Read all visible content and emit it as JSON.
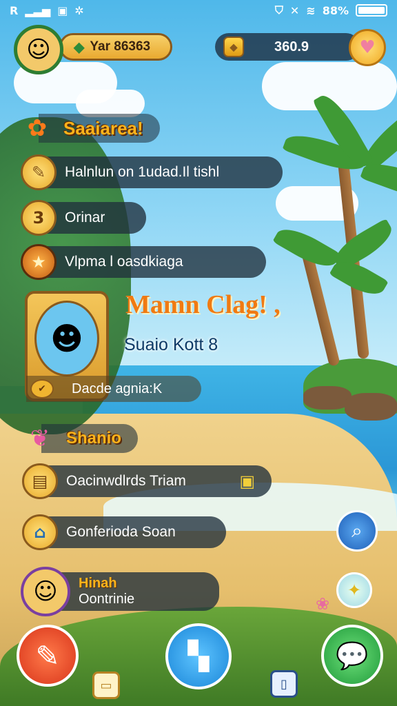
{
  "status_bar": {
    "left_text": "R",
    "battery_text": "88%"
  },
  "hud": {
    "username": "Yar 86363",
    "coins": "360.9"
  },
  "menu": {
    "section_title": "Saaiarea!",
    "items": [
      {
        "label": "Halnlun on 1udad.Il tishl",
        "icon": "pencil-icon"
      },
      {
        "label": "Orinar",
        "icon": "number-3-icon"
      },
      {
        "label": "Vlpma l oasdkiaga",
        "icon": "star-icon"
      }
    ]
  },
  "promo": {
    "title": "Mamn Clag! ,",
    "subtitle": "Suaio Kott 8",
    "card_label": "Dacde agnia:K"
  },
  "shop": {
    "section_title": "Shanio",
    "items": [
      {
        "label": "Oacinwdlrds Triam",
        "icon": "chest-icon"
      },
      {
        "label": "Gonferioda Soan",
        "icon": "house-icon"
      }
    ]
  },
  "profile": {
    "name": "Hinah",
    "status": "Oontrinie"
  },
  "colors": {
    "accent_gold": "#f0b530",
    "pill_dark": "#20303c",
    "button_red": "#e8452a",
    "button_blue": "#1e8fe0",
    "button_green": "#2fb14a"
  }
}
